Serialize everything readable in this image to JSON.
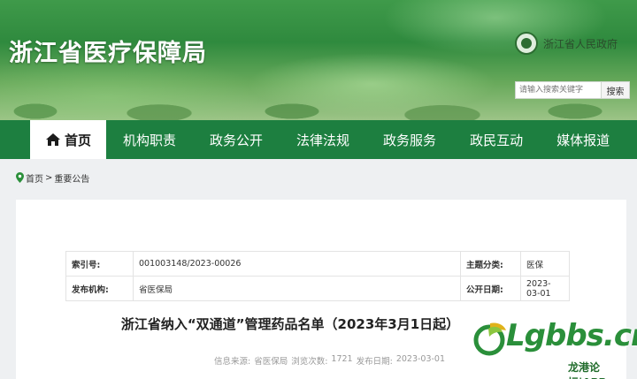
{
  "header": {
    "site_title": "浙江省医疗保障局",
    "gov_link_label": "浙江省人民政府",
    "gov_icon": "national-emblem-icon",
    "search": {
      "placeholder": "请输入搜索关键字",
      "button_label": "搜索"
    }
  },
  "nav": {
    "items": [
      {
        "label": "首页",
        "icon": "home-icon",
        "active": true
      },
      {
        "label": "机构职责"
      },
      {
        "label": "政务公开"
      },
      {
        "label": "法律法规"
      },
      {
        "label": "政务服务"
      },
      {
        "label": "政民互动"
      },
      {
        "label": "媒体报道"
      }
    ],
    "active_color": "#ffffff",
    "bar_color": "#1d7f40"
  },
  "breadcrumb": {
    "icon": "location-pin-icon",
    "home": "首页",
    "separator": ">",
    "current": "重要公告"
  },
  "meta": {
    "rows": [
      {
        "k1": "索引号:",
        "v1": "001003148/2023-00026",
        "k2": "主题分类:",
        "v2": "医保"
      },
      {
        "k1": "发布机构:",
        "v1": "省医保局",
        "k2": "公开日期:",
        "v2": "2023-03-01"
      }
    ]
  },
  "article": {
    "title": "浙江省纳入“双通道”管理药品名单（2023年3月1日起）",
    "source_label": "信息来源:",
    "source_value": "省医保局",
    "views_label": "浏览次数:",
    "views_value": "1721",
    "date_label": "发布日期:",
    "date_value": "2023-03-01"
  },
  "watermark": {
    "brand": "Lgbbs.cn",
    "subtitle": "龙港论坛|APP"
  }
}
